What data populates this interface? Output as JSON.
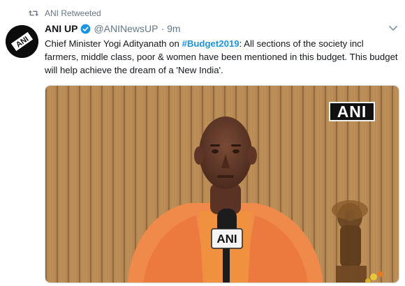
{
  "retweet": {
    "icon": "retweet-icon",
    "label": "ANI Retweeted"
  },
  "tweet": {
    "avatar_text": "ANI",
    "name": "ANI UP",
    "verified_icon": "verified-badge-icon",
    "handle": "@ANINewsUP",
    "separator": "·",
    "time": "9m",
    "text_before": "Chief Minister Yogi Adityanath on ",
    "hashtag": "#Budget2019",
    "text_after": ": All sections of the society incl farmers, middle class, poor & women have been mentioned in this budget. This budget will help achieve the dream of a 'New India'.",
    "menu_icon": "chevron-down-icon"
  },
  "media": {
    "watermark": "ANI",
    "mic_label": "ANI"
  },
  "colors": {
    "accent": "#1b95e0",
    "muted": "#657786",
    "text": "#14171a"
  }
}
